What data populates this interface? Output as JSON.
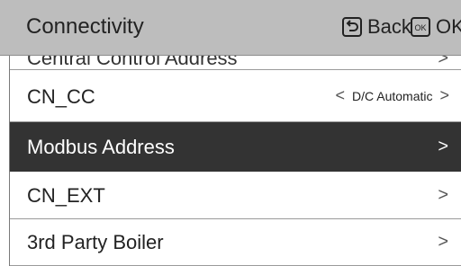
{
  "header": {
    "title": "Connectivity",
    "back_label": "Back",
    "ok_label": "OK"
  },
  "rows": [
    {
      "label": "Central Control Address",
      "partially_visible": true
    },
    {
      "label": "CN_CC",
      "value": "D/C Automatic",
      "left_arrow": "<",
      "right_arrow": ">"
    },
    {
      "label": "Modbus Address",
      "selected": true
    },
    {
      "label": "CN_EXT"
    },
    {
      "label": "3rd Party Boiler"
    }
  ],
  "chevron": ">",
  "colors": {
    "header_bg": "#bdbdbd",
    "selected_bg": "#333333",
    "text": "#222222"
  }
}
